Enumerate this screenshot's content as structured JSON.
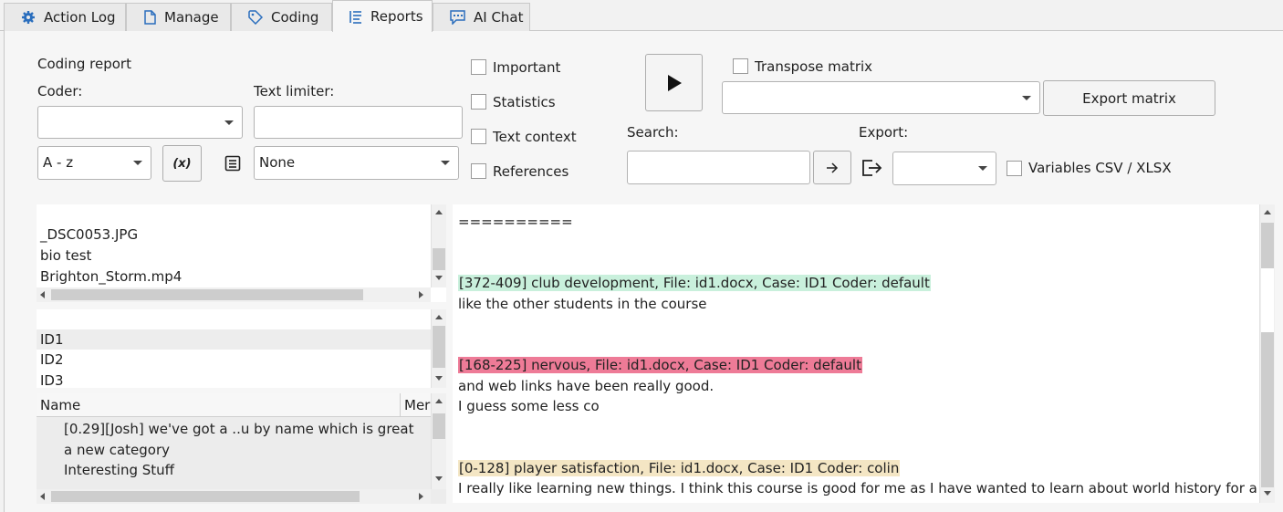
{
  "tabs": [
    {
      "label": "Action Log",
      "icon": "gear-icon"
    },
    {
      "label": "Manage",
      "icon": "document-icon"
    },
    {
      "label": "Coding",
      "icon": "tag-icon"
    },
    {
      "label": "Reports",
      "icon": "list-icon",
      "active": true
    },
    {
      "label": "AI Chat",
      "icon": "chat-icon"
    }
  ],
  "controls": {
    "coding_report_label": "Coding report",
    "coder_label": "Coder:",
    "coder_value": "",
    "text_limiter_label": "Text limiter:",
    "text_limiter_value": "",
    "sort_value": "A - z",
    "variable_button": "(x)",
    "limiter_type_value": "None",
    "important_label": "Important",
    "statistics_label": "Statistics",
    "text_context_label": "Text context",
    "references_label": "References",
    "search_label": "Search:",
    "search_value": "",
    "export_label": "Export:",
    "export_value": "",
    "transpose_label": "Transpose matrix",
    "matrix_value": "",
    "export_matrix_label": "Export matrix",
    "variables_csv_label": "Variables CSV / XLSX"
  },
  "files_list": [
    "_DSC0053.JPG",
    "bio test",
    "Brighton_Storm.mp4"
  ],
  "cases_list": [
    "ID1",
    "ID2",
    "ID3"
  ],
  "codes_table": {
    "headers": [
      "Name",
      "Mer"
    ],
    "rows": [
      "[0.29][Josh] we've got a ..u by name which is great",
      "a new category",
      "Interesting Stuff"
    ]
  },
  "report": {
    "separator": "==========",
    "entries": [
      {
        "header": "[372-409] club development, File: id1.docx,  Case: ID1 Coder: default",
        "color": "#c9f0dc",
        "lines": [
          "like the other students in the course"
        ]
      },
      {
        "header": "[168-225] nervous, File: id1.docx,  Case: ID1 Coder: default",
        "color": "#ee7b97",
        "lines": [
          "and web links have been really good.",
          "I guess some less co"
        ]
      },
      {
        "header": "[0-128] player satisfaction, File: id1.docx,  Case: ID1 Coder: colin",
        "color": "#f4e6c4",
        "lines": [
          "I really like learning new things. I think this course is good for me as I have wanted to learn about world history for a"
        ]
      }
    ]
  }
}
